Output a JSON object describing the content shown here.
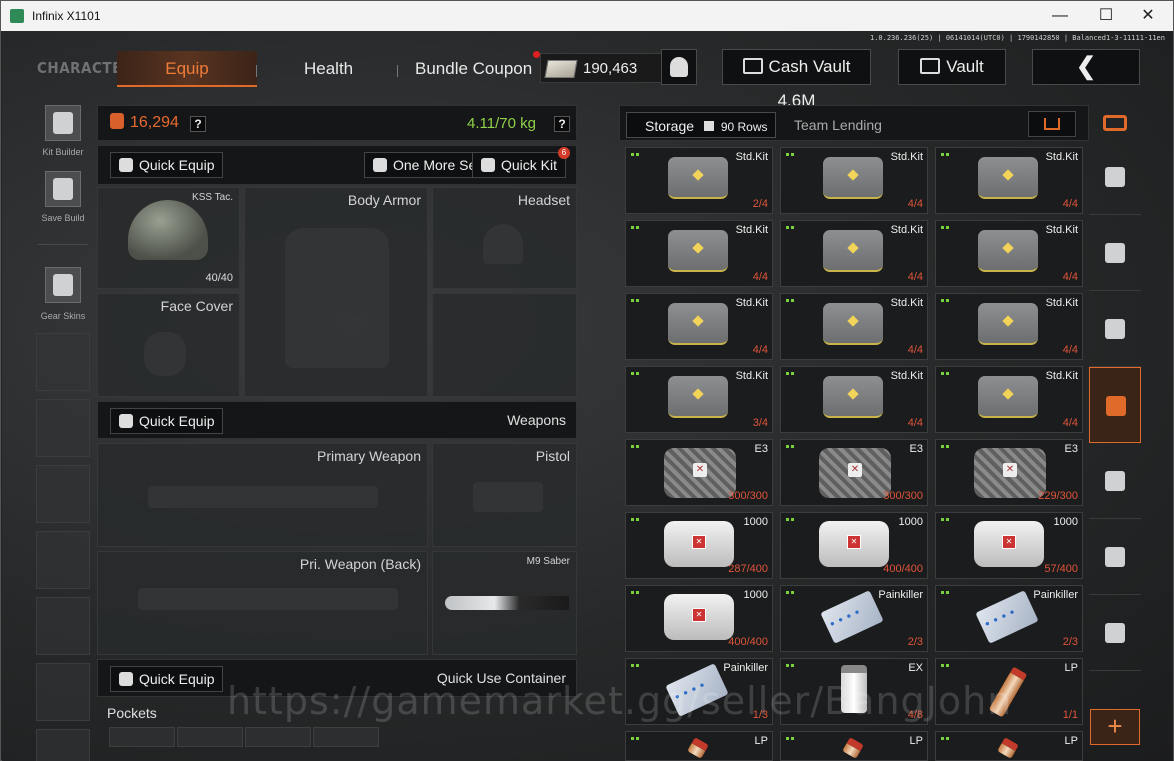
{
  "window": {
    "title": "Infinix X1101",
    "minimize": "—",
    "maximize": "☐",
    "close": "✕"
  },
  "version": "1.0.236.236(25) | 06141014(UTC0) | 1790142850 | Balanced1-3-11111-11en",
  "tabs": {
    "character": "CHARACTER",
    "equip": "Equip",
    "health": "Health",
    "bundle": "Bundle Coupon"
  },
  "money": "190,463",
  "buttons": {
    "cash_vault": "Cash Vault 4.6M",
    "vault": "Vault",
    "back": "❮"
  },
  "left_nav": [
    {
      "label": "Kit Builder",
      "icon": "vest-icon"
    },
    {
      "label": "Save Build",
      "icon": "download-icon"
    },
    {
      "label": "Gear Skins",
      "icon": "helmet-skin-icon"
    }
  ],
  "equip": {
    "cash": "16,294",
    "weight": "4.11/70 kg",
    "help": "?",
    "quick_equip": "Quick Equip",
    "one_more_set": "One More Set",
    "quick_kit": "Quick Kit",
    "quick_kit_badge": "6",
    "slots": {
      "helmet": {
        "name": "KSS Tac.",
        "count": "40/40"
      },
      "body_armor": "Body Armor",
      "headset": "Headset",
      "face_cover": "Face Cover"
    },
    "weapons_header": "Weapons",
    "weapons_quick_equip": "Quick Equip",
    "primary": "Primary Weapon",
    "pistol": "Pistol",
    "primary_back": "Pri. Weapon (Back)",
    "melee": "M9 Saber",
    "quick_use_equip": "Quick Equip",
    "quick_use_container": "Quick Use Container",
    "pockets": "Pockets"
  },
  "storage": {
    "tab_storage": "Storage",
    "rows": "90 Rows",
    "tab_lending": "Team Lending",
    "items": [
      {
        "name": "Std.Kit",
        "qty": "2/4",
        "type": "kit",
        "qty_color": "#e0553a"
      },
      {
        "name": "Std.Kit",
        "qty": "4/4",
        "type": "kit",
        "qty_color": "#e0553a"
      },
      {
        "name": "Std.Kit",
        "qty": "4/4",
        "type": "kit",
        "qty_color": "#e0553a"
      },
      {
        "name": "Std.Kit",
        "qty": "4/4",
        "type": "kit",
        "qty_color": "#e0553a"
      },
      {
        "name": "Std.Kit",
        "qty": "4/4",
        "type": "kit",
        "qty_color": "#e0553a"
      },
      {
        "name": "Std.Kit",
        "qty": "4/4",
        "type": "kit",
        "qty_color": "#e0553a"
      },
      {
        "name": "Std.Kit",
        "qty": "4/4",
        "type": "kit",
        "qty_color": "#e0553a"
      },
      {
        "name": "Std.Kit",
        "qty": "4/4",
        "type": "kit",
        "qty_color": "#e0553a"
      },
      {
        "name": "Std.Kit",
        "qty": "4/4",
        "type": "kit",
        "qty_color": "#e0553a"
      },
      {
        "name": "Std.Kit",
        "qty": "3/4",
        "type": "kit",
        "qty_color": "#e0553a"
      },
      {
        "name": "Std.Kit",
        "qty": "4/4",
        "type": "kit",
        "qty_color": "#e0553a"
      },
      {
        "name": "Std.Kit",
        "qty": "4/4",
        "type": "kit",
        "qty_color": "#e0553a"
      },
      {
        "name": "E3",
        "qty": "300/300",
        "type": "e3",
        "qty_color": "#e0553a"
      },
      {
        "name": "E3",
        "qty": "300/300",
        "type": "e3",
        "qty_color": "#e0553a"
      },
      {
        "name": "E3",
        "qty": "229/300",
        "type": "e3",
        "qty_color": "#e0553a"
      },
      {
        "name": "1000",
        "qty": "287/400",
        "type": "med1k",
        "qty_color": "#e0553a"
      },
      {
        "name": "1000",
        "qty": "400/400",
        "type": "med1k",
        "qty_color": "#e0553a"
      },
      {
        "name": "1000",
        "qty": "57/400",
        "type": "med1k",
        "qty_color": "#e0553a"
      },
      {
        "name": "1000",
        "qty": "400/400",
        "type": "med1k",
        "qty_color": "#e0553a"
      },
      {
        "name": "Painkiller",
        "qty": "2/3",
        "type": "pain",
        "qty_color": "#e0553a"
      },
      {
        "name": "Painkiller",
        "qty": "2/3",
        "type": "pain",
        "qty_color": "#e0553a"
      },
      {
        "name": "Painkiller",
        "qty": "1/3",
        "type": "pain",
        "qty_color": "#e0553a"
      },
      {
        "name": "EX",
        "qty": "4/8",
        "type": "ex",
        "qty_color": "#e0553a"
      },
      {
        "name": "LP",
        "qty": "1/1",
        "type": "lp",
        "qty_color": "#e0553a"
      },
      {
        "name": "LP",
        "qty": "",
        "type": "lp",
        "qty_color": "#e0553a"
      },
      {
        "name": "LP",
        "qty": "",
        "type": "lp",
        "qty_color": "#e0553a"
      },
      {
        "name": "LP",
        "qty": "",
        "type": "lp",
        "qty_color": "#e0553a"
      }
    ]
  },
  "side_tabs": [
    "home-icon",
    "armor-icon",
    "grenade-icon",
    "medkit-icon",
    "key-icon",
    "cash-icon",
    "box-icon"
  ],
  "plus": "+",
  "watermark": "https://gamemarket.gg/seller/BangJohn"
}
